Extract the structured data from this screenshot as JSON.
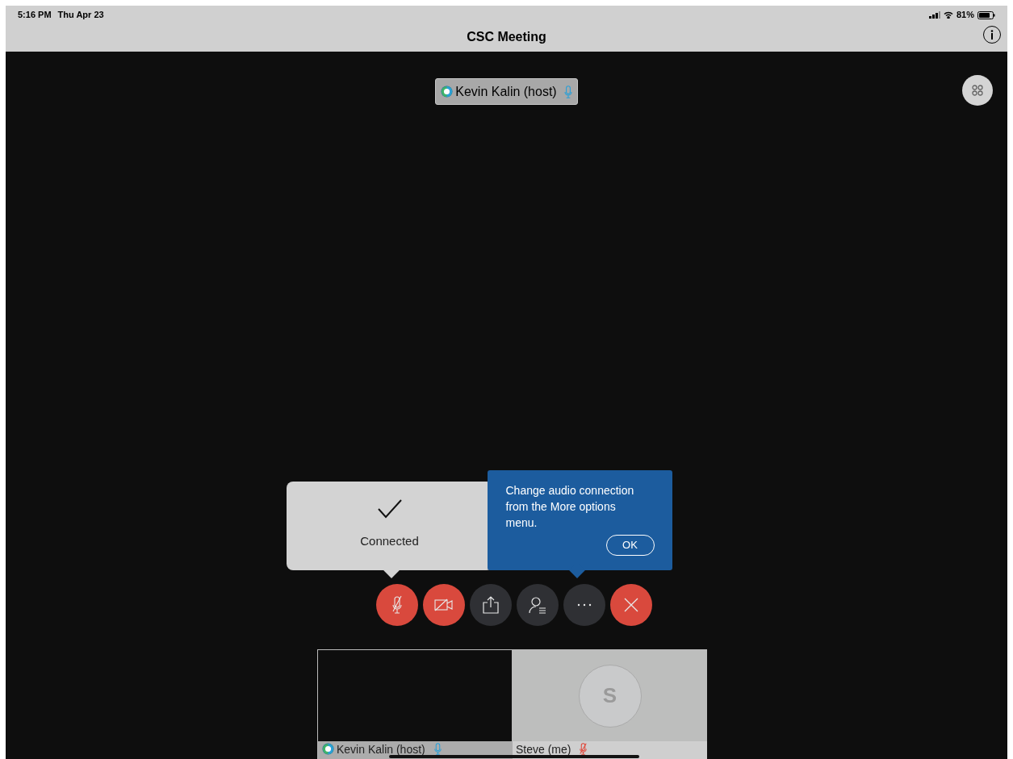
{
  "status_bar": {
    "time": "5:16 PM",
    "date": "Thu Apr 23",
    "battery": "81%"
  },
  "title_bar": {
    "title": "CSC Meeting"
  },
  "active_speaker": {
    "name": "Kevin Kalin (host)",
    "muted": false
  },
  "connected_popup": {
    "label": "Connected"
  },
  "tip_popup": {
    "text": "Change audio connection from the More options menu.",
    "button": "OK"
  },
  "toolbar": [
    {
      "kind": "mic",
      "muted": true
    },
    {
      "kind": "video",
      "muted": true
    },
    {
      "kind": "share",
      "muted": false
    },
    {
      "kind": "participants",
      "muted": false
    },
    {
      "kind": "more",
      "muted": false
    },
    {
      "kind": "leave"
    }
  ],
  "thumbnails": [
    {
      "kind": "video",
      "name": "Kevin Kalin (host)",
      "muted": false
    },
    {
      "kind": "avatar",
      "initial": "S",
      "name": "Steve (me)",
      "muted": true
    }
  ]
}
